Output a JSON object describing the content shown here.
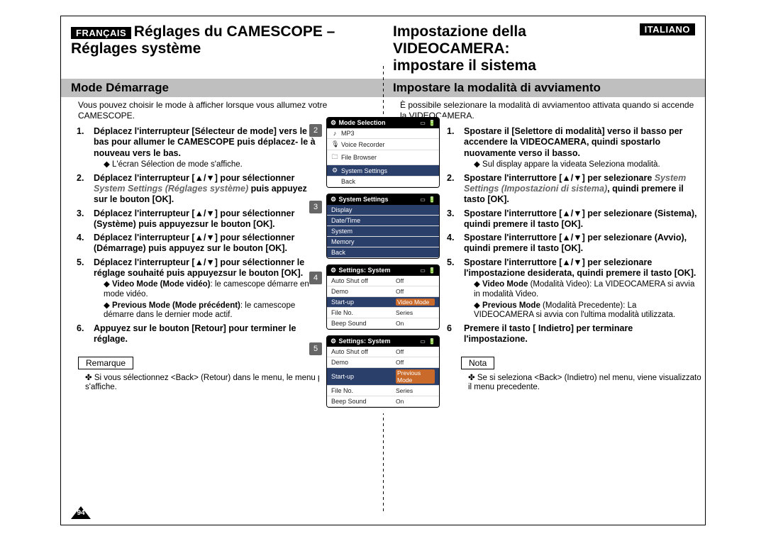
{
  "header": {
    "left": {
      "lang": "FRANÇAIS",
      "title1": "Réglages du CAMESCOPE –",
      "title2": "Réglages système"
    },
    "right": {
      "lang": "ITALIANO",
      "title1": "Impostazione della VIDEOCAMERA:",
      "title2": "impostare il sistema"
    }
  },
  "section": {
    "left": "Mode Démarrage",
    "right": "Impostare la modalità di avviamento"
  },
  "intro": {
    "left": "Vous pouvez choisir le mode à afficher lorsque vous allumez votre CAMESCOPE.",
    "right": "È possibile selezionare la modalità di avviamentoo attivata quando si accende la VIDEOCAMERA."
  },
  "steps_left": [
    {
      "n": "1.",
      "b": "Déplacez l'interrupteur [Sélecteur de mode] vers le bas pour allumer le CAMESCOPE puis déplacez- le à nouveau vers le bas.",
      "sub": "L'écran Sélection de mode s'affiche."
    },
    {
      "n": "2.",
      "b": "Déplacez l'interrupteur [▲/▼] pour sélectionner ",
      "e": "System Settings (Réglages système)",
      "b2": " puis appuyez sur le bouton [OK]."
    },
    {
      "n": "3.",
      "b": "Déplacez l'interrupteur [▲/▼] pour sélectionner <System> (Système) puis appuyezsur le bouton [OK]."
    },
    {
      "n": "4.",
      "b": "Déplacez l'interrupteur [▲/▼] pour sélectionner <Start-up> (Démarrage) puis appuyez sur le bouton [OK]."
    },
    {
      "n": "5.",
      "b": "Déplacez l'interrupteur [▲/▼] pour sélectionner le réglage souhaité puis appuyezsur le bouton [OK].",
      "subs": [
        {
          "t": "Video Mode (Mode vidéo)",
          "d": ": le camescope démarre en mode vidéo."
        },
        {
          "t": "Previous Mode (Mode précédent)",
          "d": ": le camescope démarre dans le dernier mode actif."
        }
      ]
    },
    {
      "n": "6.",
      "b": "Appuyez sur le bouton [Retour] pour terminer le réglage."
    }
  ],
  "steps_right": [
    {
      "n": "1.",
      "b": "Spostare il [Selettore di modalità] verso il basso per accendere la VIDEOCAMERA, quindi spostarlo nuovamente verso il basso.",
      "sub": "Sul display appare la videata Seleziona modalità."
    },
    {
      "n": "2.",
      "b": "Spostare l'interruttore [▲/▼] per selezionare ",
      "e": "System Settings (Impostazioni di sistema)",
      "b2": ", quindi premere il tasto [OK]."
    },
    {
      "n": "3.",
      "b": "Spostare l'interruttore [▲/▼] per selezionare <System> (Sistema), quindi premere il tasto [OK]."
    },
    {
      "n": "4.",
      "b": "Spostare l'interruttore [▲/▼] per selezionare <Start-up> (Avvio), quindi premere il tasto [OK]."
    },
    {
      "n": "5.",
      "b": "Spostare l'interruttore [▲/▼] per selezionare l'impostazione desiderata, quindi premere il tasto [OK].",
      "subs": [
        {
          "t": "Video Mode",
          "d": " (Modalità Video): La VIDEOCAMERA si avvia in modalità Video."
        },
        {
          "t": "Previous Mode",
          "d": " (Modalità Precedente): La VIDEOCAMERA si avvia con l'ultima modalità utilizzata."
        }
      ]
    },
    {
      "n": "6",
      "b": "Premere il tasto [ Indietro] per terminare l'impostazione."
    }
  ],
  "note": {
    "left_label": "Remarque",
    "left_text": "Si vous sélectionnez <Back> (Retour) dans le menu, le menu précédent s'affiche.",
    "right_label": "Nota",
    "right_text": "Se si seleziona <Back> (Indietro) nel menu, viene visualizzato il menu precedente."
  },
  "page_number": "94",
  "screens": [
    {
      "num": "2",
      "title": "Mode Selection",
      "rows": [
        {
          "icon": "♪",
          "label": "MP3"
        },
        {
          "icon": "🎙",
          "label": "Voice Recorder"
        },
        {
          "icon": "🗀",
          "label": "File Browser"
        },
        {
          "icon": "⚙",
          "label": "System Settings",
          "selected": true
        },
        {
          "icon": "",
          "label": "Back"
        }
      ]
    },
    {
      "num": "3",
      "title": "System Settings",
      "rows": [
        {
          "label": "Display",
          "selected": true
        },
        {
          "label": "Date/Time"
        },
        {
          "label": "System"
        },
        {
          "label": "Memory"
        },
        {
          "label": "Back"
        }
      ],
      "style": "blue-rows"
    },
    {
      "num": "4",
      "title": "Settings: System",
      "rows": [
        {
          "label": "Auto Shut off",
          "val": "Off"
        },
        {
          "label": "Demo",
          "val": "Off"
        },
        {
          "label": "Start-up",
          "val": "Video Mode",
          "selected": true,
          "orange": true
        },
        {
          "label": "File No.",
          "val": "Series"
        },
        {
          "label": "Beep Sound",
          "val": "On"
        }
      ]
    },
    {
      "num": "5",
      "title": "Settings: System",
      "rows": [
        {
          "label": "Auto Shut off",
          "val": "Off"
        },
        {
          "label": "Demo",
          "val": "Off"
        },
        {
          "label": "Start-up",
          "val": "Previous Mode",
          "selected": true,
          "orange": true
        },
        {
          "label": "File No.",
          "val": "Series"
        },
        {
          "label": "Beep Sound",
          "val": "On"
        }
      ]
    }
  ]
}
